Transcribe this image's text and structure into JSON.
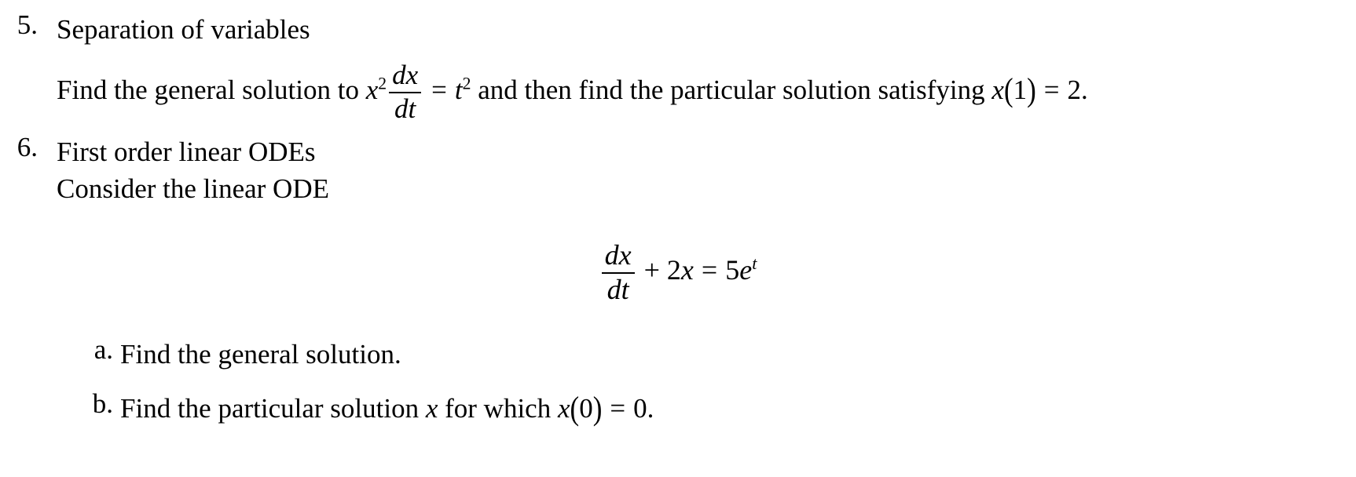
{
  "document": {
    "background_color": "#ffffff",
    "text_color": "#000000",
    "items": [
      {
        "marker": "5.",
        "title": "Separation of variables",
        "body_prefix": "Find the general solution to ",
        "body_middle": " and then find the particular solution satisfying ",
        "body_suffix": "."
      },
      {
        "marker": "6.",
        "title": "First order linear ODEs",
        "subtitle": "Consider the linear ODE"
      }
    ]
  },
  "math": {
    "item5": {
      "lhs_var": "x",
      "lhs_exponent": "2",
      "frac_numerator_d": "d",
      "frac_numerator_var": "x",
      "frac_denominator_d": "d",
      "frac_denominator_var": "t",
      "equals": "=",
      "rhs_var": "t",
      "rhs_exponent": "2",
      "condition_func": "x",
      "condition_open": "(",
      "condition_arg": "1",
      "condition_close": ")",
      "condition_equals": "=",
      "condition_value": "2"
    },
    "display": {
      "frac_numerator_d": "d",
      "frac_numerator_var": "x",
      "frac_denominator_d": "d",
      "frac_denominator_var": "t",
      "plus": "+",
      "coefficient": "2",
      "variable": "x",
      "equals": "=",
      "rhs_coefficient": "5",
      "rhs_base": "e",
      "rhs_exponent": "t",
      "latex": "\\frac{dx}{dt} + 2x = 5e^t"
    },
    "item6b": {
      "var": "x",
      "func": "x",
      "open": "(",
      "arg": "0",
      "close": ")",
      "equals": "=",
      "value": "0"
    }
  },
  "sub_items": [
    {
      "marker": "a.",
      "text": "Find the general solution."
    },
    {
      "marker": "b.",
      "text_prefix": "Find the particular solution ",
      "text_middle": " for which ",
      "text_suffix": "."
    }
  ]
}
